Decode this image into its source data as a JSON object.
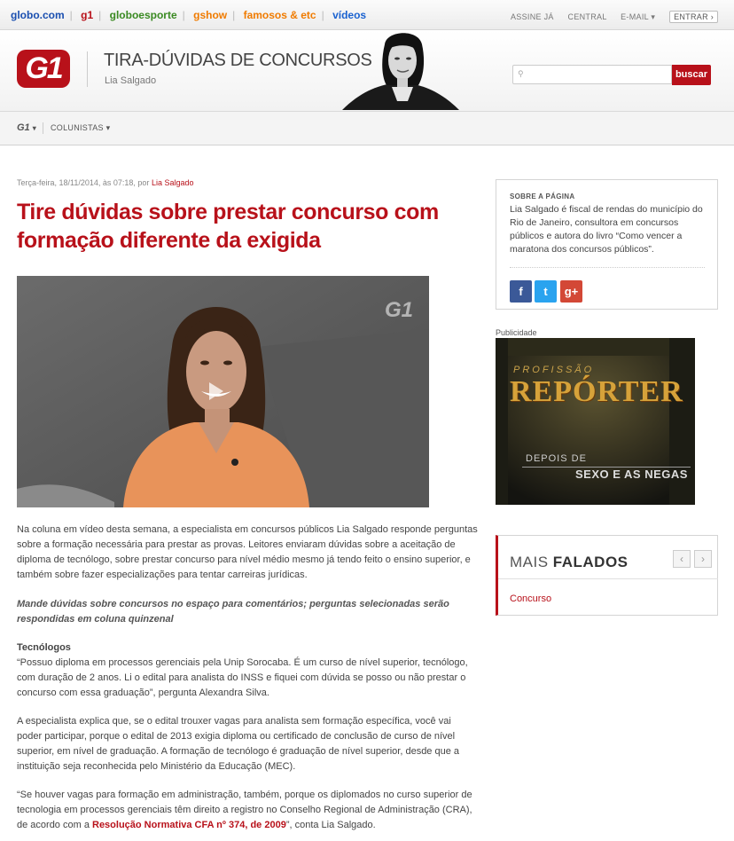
{
  "topbar": {
    "links": [
      {
        "label": "globo.com",
        "color": "#1a4fb0"
      },
      {
        "label": "g1",
        "color": "#b8111a"
      },
      {
        "label": "globoesporte",
        "color": "#3a8a22"
      },
      {
        "label": "gshow",
        "color": "#f07b00"
      },
      {
        "label": "famosos & etc",
        "color": "#f07b00"
      },
      {
        "label": "vídeos",
        "color": "#1a62d0"
      }
    ],
    "assine": "ASSINE JÁ",
    "central": "CENTRAL",
    "email": "E-MAIL",
    "entrar": "ENTRAR"
  },
  "header": {
    "logo": "G1",
    "title": "TIRA-DÚVIDAS DE CONCURSOS",
    "author": "Lia Salgado",
    "search_button": "buscar"
  },
  "nav": {
    "g1": "G1",
    "colunistas": "COLUNISTAS"
  },
  "article": {
    "meta_date": "Terça-feira, 18/11/2014, às 07:18, por ",
    "meta_author": "Lia Salgado",
    "headline": "Tire dúvidas sobre prestar concurso com formação diferente da exigida",
    "p1": "Na coluna em vídeo desta semana, a especialista em concursos públicos Lia Salgado responde perguntas sobre a formação necessária para prestar as provas. Leitores enviaram dúvidas sobre a aceitação de diploma de tecnólogo, sobre prestar concurso para nível médio mesmo já tendo feito o ensino superior, e também sobre fazer especializações para tentar carreiras jurídicas.",
    "p2": "Mande dúvidas sobre concursos no espaço para comentários; perguntas selecionadas serão respondidas em coluna quinzenal",
    "section": "Tecnólogos",
    "p3": "“Possuo diploma em processos gerenciais pela Unip Sorocaba. É um curso de nível superior, tecnólogo, com duração de 2 anos. Li o edital para analista do INSS e fiquei com dúvida se posso ou não prestar o concurso com essa graduação”, pergunta Alexandra Silva.",
    "p4": "A especialista explica que, se o edital trouxer vagas para analista sem formação específica, você vai poder participar, porque o edital de 2013 exigia diploma ou certificado de conclusão de curso de nível superior, em nível de graduação. A formação de tecnólogo é graduação de nível superior, desde que a instituição seja reconhecida pelo Ministério da Educação (MEC).",
    "p5_a": "“Se houver vagas para formação em administração, também, porque os diplomados no curso superior de tecnologia em processos gerenciais têm direito a registro no Conselho Regional de Administração (CRA), de acordo com a ",
    "p5_link": "Resolução Normativa CFA nº 374, de 2009",
    "p5_b": "”, conta Lia Salgado."
  },
  "video": {
    "watermark": "G1"
  },
  "sidebar": {
    "about_title": "SOBRE A PÁGINA",
    "about_text": "Lia Salgado é fiscal de rendas do município do Rio de Janeiro, consultora em concursos públicos e autora do livro “Como vencer a maratona dos concursos públicos”.",
    "social": [
      {
        "icon": "facebook-icon",
        "glyph": "f",
        "color": "#3b5998"
      },
      {
        "icon": "twitter-icon",
        "glyph": "t",
        "color": "#2aa3ef"
      },
      {
        "icon": "google-plus-icon",
        "glyph": "g+",
        "color": "#d34836"
      }
    ],
    "publicidade": "Publicidade",
    "ad": {
      "line1": "PROFISSÃO",
      "line2": "REPÓRTER",
      "line3": "DEPOIS DE",
      "line4": "SEXO E AS NEGAS"
    },
    "mais_light": "MAIS ",
    "mais_bold": "FALADOS",
    "mais_item": "Concurso"
  }
}
